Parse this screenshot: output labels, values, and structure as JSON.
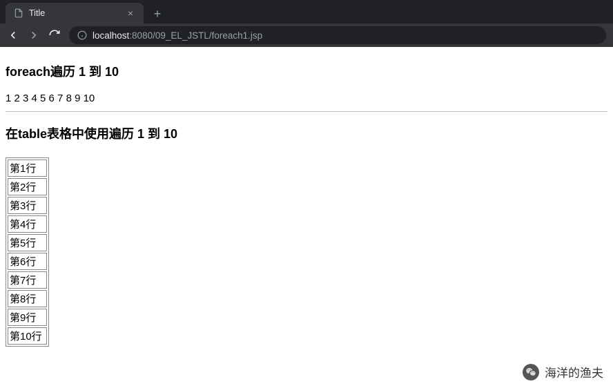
{
  "browser": {
    "tab_title": "Title",
    "url_host": "localhost",
    "url_rest": ":8080/09_EL_JSTL/foreach1.jsp"
  },
  "content": {
    "heading1": "foreach遍历 1 到 10",
    "numbers": "1 2 3 4 5 6 7 8 9 10",
    "heading2": "在table表格中使用遍历 1 到 10",
    "rows": [
      "第1行",
      "第2行",
      "第3行",
      "第4行",
      "第5行",
      "第6行",
      "第7行",
      "第8行",
      "第9行",
      "第10行"
    ]
  },
  "watermark": {
    "text": "海洋的渔夫"
  }
}
